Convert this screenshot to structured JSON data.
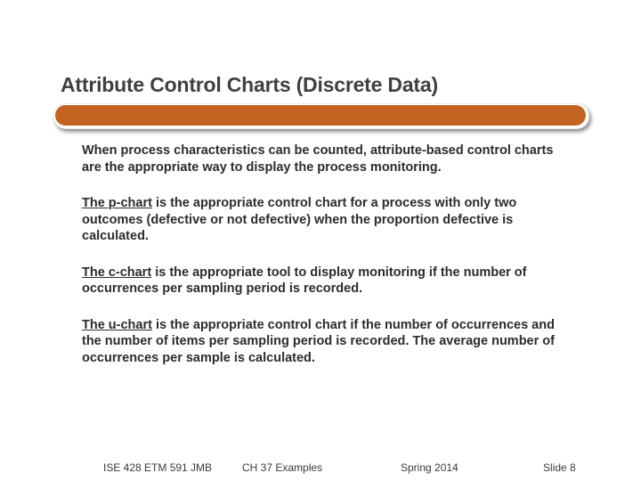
{
  "title": "Attribute Control Charts (Discrete Data)",
  "paragraphs": {
    "intro": "When process characteristics can be counted, attribute-based control charts are the appropriate way to display the process monitoring.",
    "p_lead": "The p-chart",
    "p_rest": " is the appropriate control chart for a process with only two outcomes (defective or not defective) when the proportion defective is calculated.",
    "c_lead": "The c-chart",
    "c_rest": " is the appropriate tool to display monitoring if the number of occurrences per sampling period is recorded.",
    "u_lead": "The u-chart",
    "u_rest": " is the appropriate control chart if the number of occurrences and the number of items per sampling period is recorded. The average number of occurrences per sample is calculated."
  },
  "footer": {
    "course": "ISE 428  ETM 591 JMB",
    "chapter": "CH 37 Examples",
    "term": "Spring 2014",
    "slide": "Slide 8"
  }
}
